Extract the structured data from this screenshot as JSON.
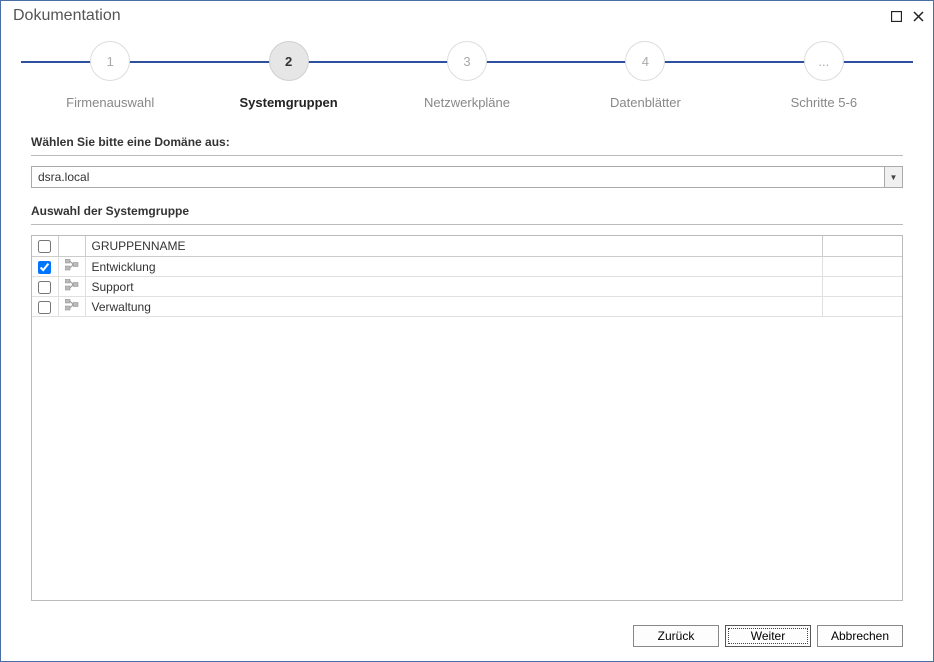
{
  "window": {
    "title": "Dokumentation"
  },
  "stepper": {
    "steps": [
      {
        "num": "1",
        "label": "Firmenauswahl"
      },
      {
        "num": "2",
        "label": "Systemgruppen"
      },
      {
        "num": "3",
        "label": "Netzwerkpläne"
      },
      {
        "num": "4",
        "label": "Datenblätter"
      },
      {
        "num": "...",
        "label": "Schritte 5-6"
      }
    ],
    "activeIndex": 1
  },
  "domain": {
    "label": "Wählen Sie bitte eine Domäne aus:",
    "value": "dsra.local"
  },
  "groups": {
    "label": "Auswahl der Systemgruppe",
    "header": "GRUPPENNAME",
    "rows": [
      {
        "checked": true,
        "name": "Entwicklung"
      },
      {
        "checked": false,
        "name": "Support"
      },
      {
        "checked": false,
        "name": "Verwaltung"
      }
    ]
  },
  "buttons": {
    "back": "Zurück",
    "next": "Weiter",
    "cancel": "Abbrechen"
  }
}
